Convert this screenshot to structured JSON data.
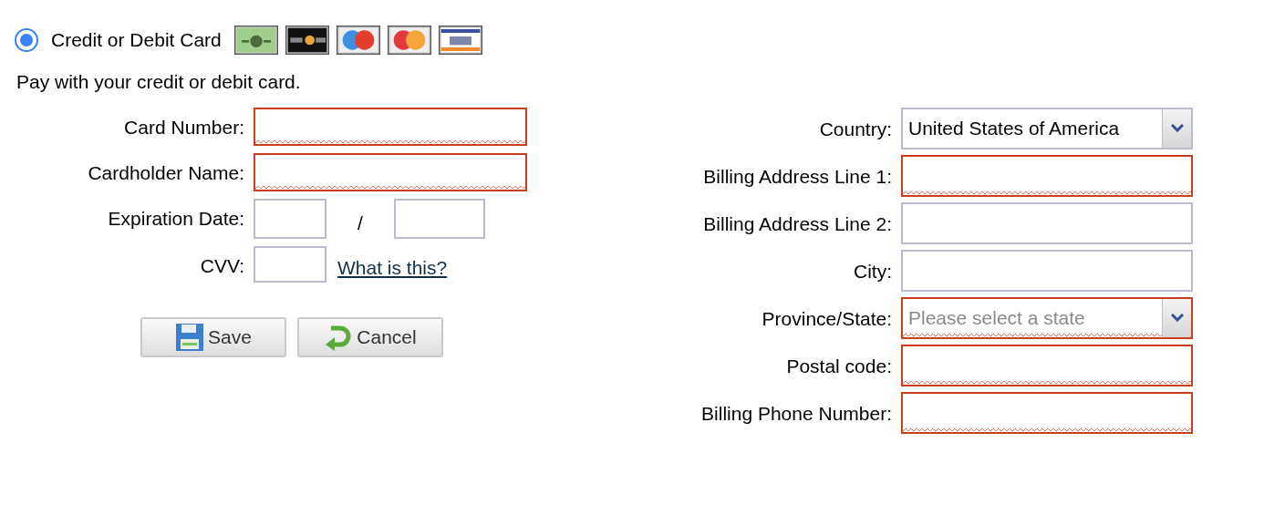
{
  "payment_option": {
    "label": "Credit or Debit Card",
    "selected": true
  },
  "description": "Pay with your credit or debit card.",
  "card_fields": [
    {
      "label": "Card Number:",
      "kind": "text",
      "invalid": true
    },
    {
      "label": "Cardholder Name:",
      "kind": "text",
      "invalid": true
    },
    {
      "label": "Expiration Date:",
      "kind": "split",
      "separator": "/",
      "inputs": [
        {
          "invalid": false
        },
        {
          "invalid": false
        }
      ]
    },
    {
      "label": "CVV:",
      "kind": "short",
      "invalid": false,
      "link": "What is this?"
    }
  ],
  "buttons": [
    {
      "label": "Save",
      "kind": "save"
    },
    {
      "label": "Cancel",
      "kind": "cancel"
    }
  ],
  "billing_fields": [
    {
      "label": "Country:",
      "kind": "select",
      "value": "United States of America",
      "invalid": false
    },
    {
      "label": "Billing Address Line 1:",
      "kind": "text",
      "invalid": true
    },
    {
      "label": "Billing Address Line 2:",
      "kind": "text",
      "invalid": false
    },
    {
      "label": "City:",
      "kind": "text",
      "invalid": false
    },
    {
      "label": "Province/State:",
      "kind": "select",
      "placeholder": "Please select a state",
      "invalid": true
    },
    {
      "label": "Postal code:",
      "kind": "text",
      "invalid": true
    },
    {
      "label": "Billing Phone Number:",
      "kind": "text",
      "invalid": true
    }
  ]
}
